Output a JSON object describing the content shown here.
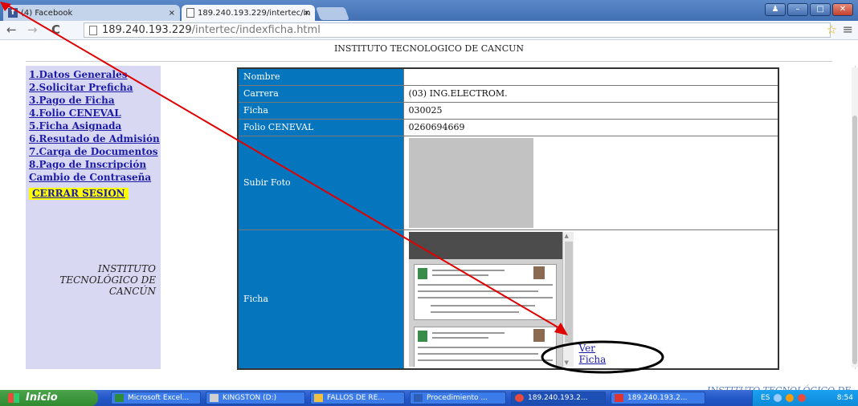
{
  "browser": {
    "tabs": [
      {
        "title": "(4) Facebook",
        "icon": "facebook-icon"
      },
      {
        "title": "189.240.193.229/intertec/in",
        "icon": "page-icon"
      }
    ],
    "tab_close": "×",
    "address_host": "189.240.193.229",
    "address_path": "/intertec/indexficha.html",
    "back": "←",
    "forward": "→",
    "reload": "C",
    "star": "☆",
    "menu": "≡"
  },
  "page": {
    "header": "INSTITUTO TECNOLOGICO DE CANCUN",
    "sidebar": {
      "items": [
        "1.Datos Generales",
        "2.Solicitar Preficha",
        "3.Pago de Ficha",
        "4.Folio CENEVAL",
        "5.Ficha Asignada",
        "6.Resutado de Admisión",
        "7.Carga de Documentos",
        "8.Pago de Inscripción",
        "Cambio de Contraseña"
      ],
      "logout": "CERRAR SESION",
      "institute": "INSTITUTO TECNOLÓGICO DE CANCÚN"
    },
    "table": {
      "rows": [
        {
          "label": "Nombre",
          "value": ""
        },
        {
          "label": "Carrera",
          "value": "(03) ING.ELECTROM."
        },
        {
          "label": "Ficha",
          "value": "030025"
        },
        {
          "label": "Folio CENEVAL",
          "value": "0260694669"
        },
        {
          "label": "Subir Foto"
        },
        {
          "label": "Ficha"
        }
      ]
    },
    "ver_ficha": "Ver Ficha",
    "footer": "INSTITUTO TECNOLÓGICO DE CANCÚN"
  },
  "taskbar": {
    "start": "Inicio",
    "tasks": [
      {
        "label": "Microsoft Excel...",
        "icon": "excel-icon",
        "color": "#2e8b3a"
      },
      {
        "label": "KINGSTON (D:)",
        "icon": "drive-icon",
        "color": "#cfcfcf"
      },
      {
        "label": "FALLOS DE RE...",
        "icon": "folder-icon",
        "color": "#f0c040"
      },
      {
        "label": "Procedimiento ...",
        "icon": "word-icon",
        "color": "#2b5fb8"
      },
      {
        "label": "189.240.193.2...",
        "icon": "chrome-icon",
        "color": "#e84c3d"
      },
      {
        "label": "189.240.193.2...",
        "icon": "pdf-icon",
        "color": "#d33"
      }
    ],
    "language": "ES",
    "clock": "8:54"
  },
  "colors": {
    "label_cell": "#0575bd",
    "sidebar_bg": "#d8d8f2",
    "link": "#1b1ba8",
    "annotation": "#e00000",
    "logout_highlight": "#ffff00"
  }
}
